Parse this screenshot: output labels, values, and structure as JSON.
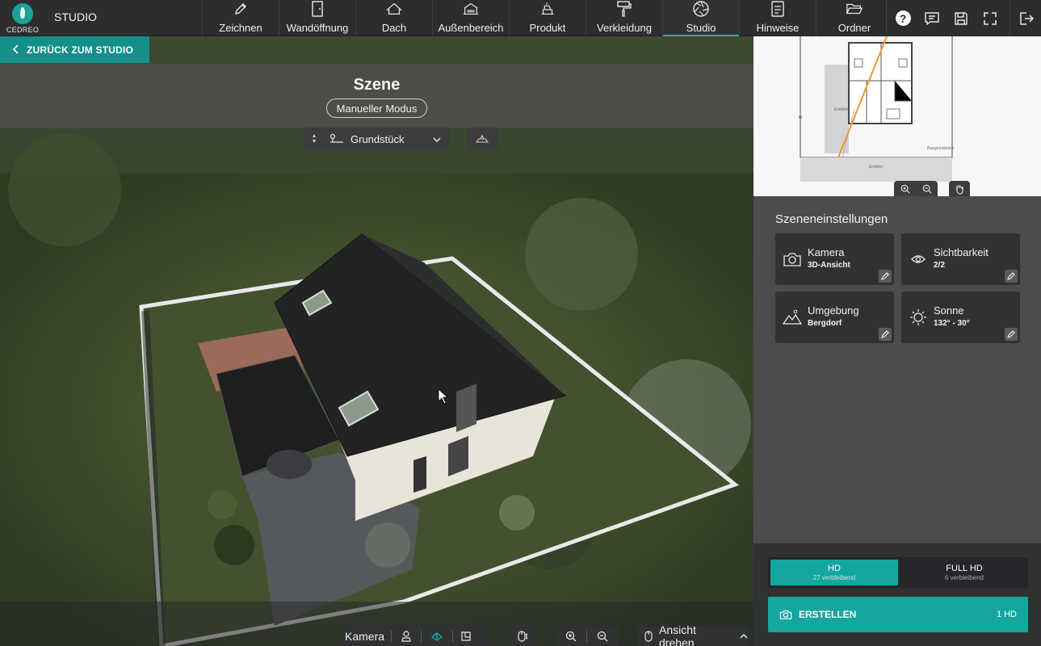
{
  "app": {
    "logo_text": "CEDREO",
    "studio_label": "STUDIO"
  },
  "nav": {
    "items": [
      {
        "label": "Zeichnen",
        "icon": "pencil-icon"
      },
      {
        "label": "Wandöffnung",
        "icon": "door-icon"
      },
      {
        "label": "Dach",
        "icon": "roof-icon"
      },
      {
        "label": "Außenbereich",
        "icon": "outdoor-icon"
      },
      {
        "label": "Produkt",
        "icon": "product-icon"
      },
      {
        "label": "Verkleidung",
        "icon": "paint-roller-icon"
      },
      {
        "label": "Studio",
        "icon": "camera-aperture-icon",
        "active": true
      },
      {
        "label": "Hinweise",
        "icon": "notes-icon"
      },
      {
        "label": "Ordner",
        "icon": "folder-icon"
      }
    ]
  },
  "actions": {
    "help": "?",
    "icons": [
      "help-icon",
      "comment-icon",
      "save-icon",
      "fullscreen-icon",
      "logout-icon"
    ]
  },
  "back": {
    "label": "ZURÜCK ZUM STUDIO"
  },
  "scene": {
    "title": "Szene",
    "mode": "Manueller Modus",
    "selector": "Grundstück"
  },
  "toolbar": {
    "camera_label": "Kamera",
    "rotate_label": "Ansicht drehen"
  },
  "settings": {
    "title": "Szeneneinstellungen",
    "cards": [
      {
        "title": "Kamera",
        "value": "3D-Ansicht",
        "icon": "camera-icon"
      },
      {
        "title": "Sichtbarkeit",
        "value": "2/2",
        "icon": "eye-icon"
      },
      {
        "title": "Umgebung",
        "value": "Bergdorf",
        "icon": "landscape-icon"
      },
      {
        "title": "Sonne",
        "value": "132° - 30°",
        "icon": "sun-icon"
      }
    ]
  },
  "render": {
    "options": [
      {
        "label": "HD",
        "remaining": "27 verbleibend",
        "active": true
      },
      {
        "label": "FULL HD",
        "remaining": "6 verbleibend",
        "active": false
      }
    ],
    "create_label": "ERSTELLEN",
    "create_cost": "1 HD"
  },
  "minimap": {
    "labels": [
      "Einfahrt",
      "Baugrundstück",
      "Einfahrt"
    ]
  },
  "colors": {
    "accent": "#13a7a0",
    "topbar": "#2b2d2f",
    "panel": "#4a4c4e",
    "card": "#2f3133"
  }
}
